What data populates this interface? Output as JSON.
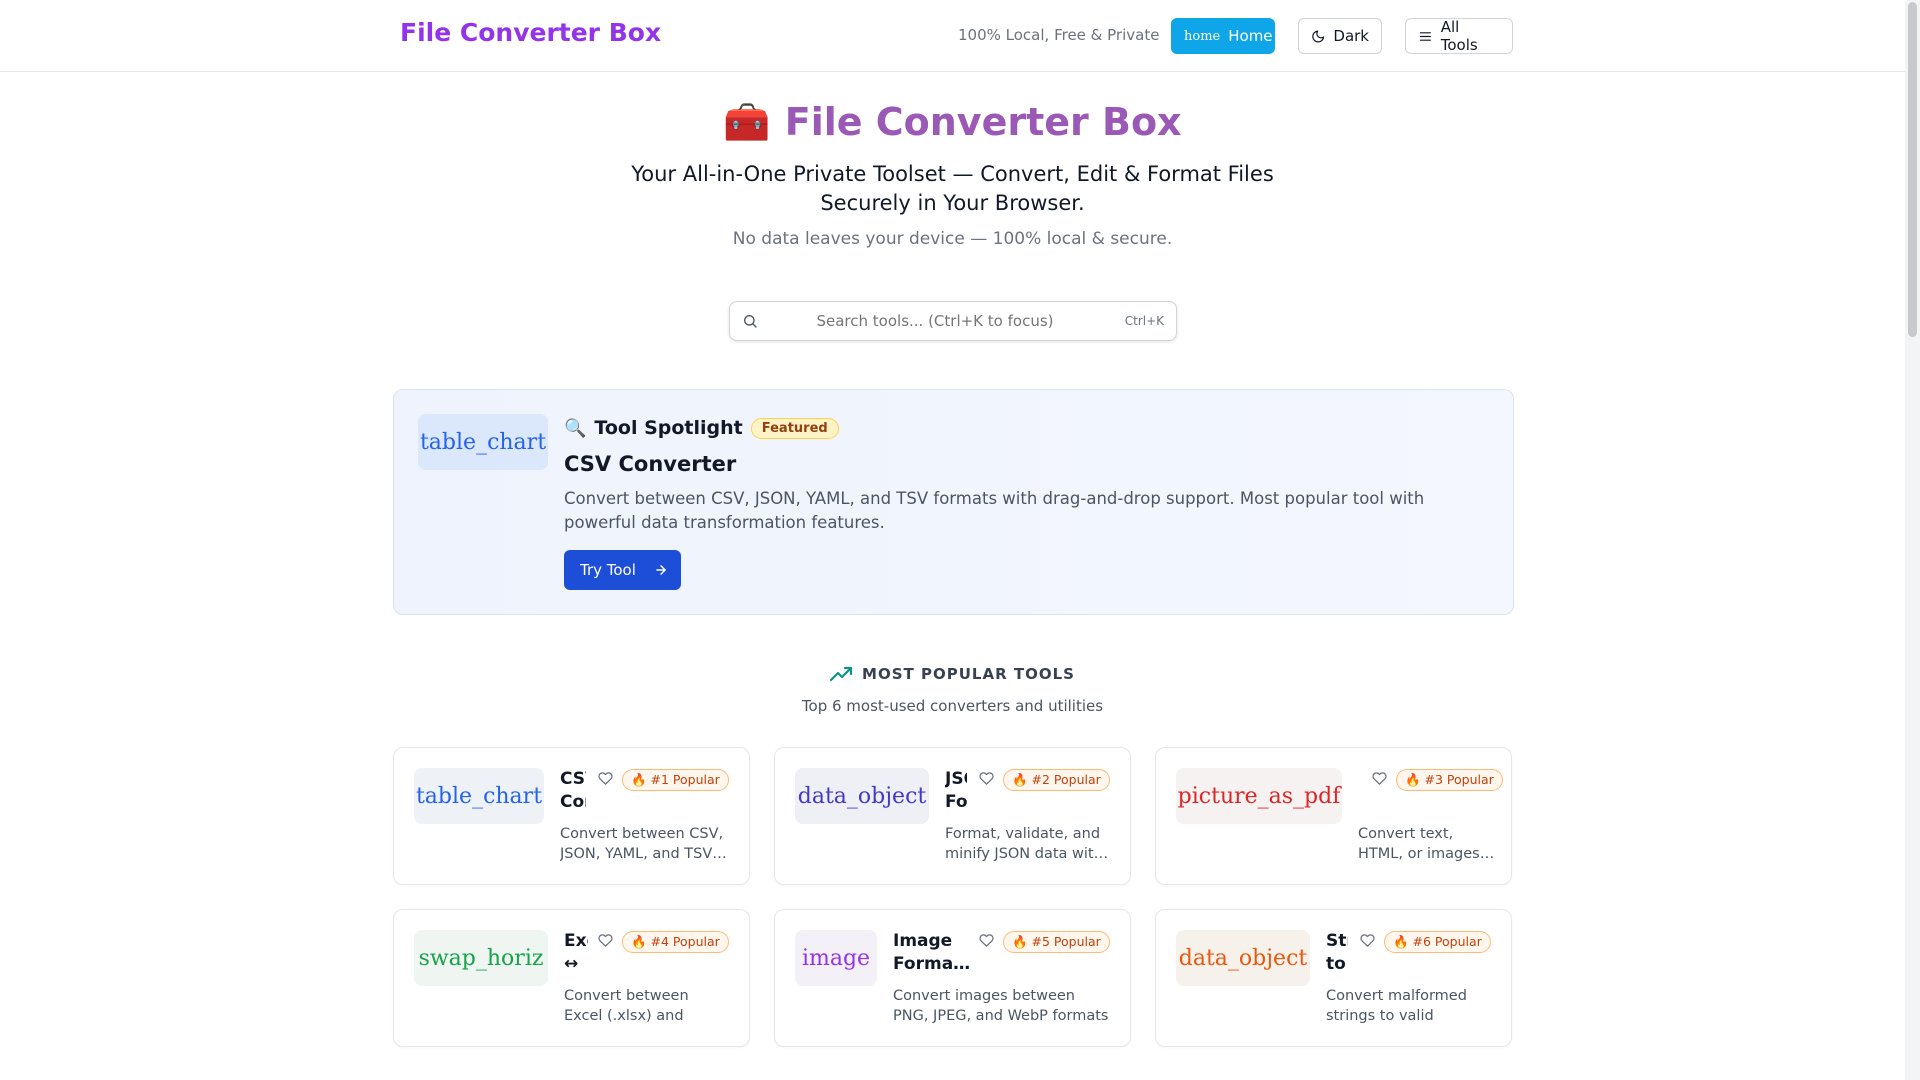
{
  "header": {
    "brand": "File Converter Box",
    "tagline": "100% Local, Free & Private",
    "home_icon": "home",
    "home_label": "Home",
    "dark_label": "Dark",
    "all_tools_label": "All Tools"
  },
  "hero": {
    "emoji": "🧰",
    "title": "File Converter Box",
    "subtitle": "Your All-in-One Private Toolset — Convert, Edit & Format Files Securely in Your Browser.",
    "note": "No data leaves your device — 100% local & secure."
  },
  "search": {
    "placeholder": "Search tools... (Ctrl+K to focus)",
    "shortcut": "Ctrl+K"
  },
  "spotlight": {
    "icon": "table_chart",
    "emoji": "🔍",
    "heading": "Tool Spotlight",
    "badge": "Featured",
    "name": "CSV Converter",
    "description": "Convert between CSV, JSON, YAML, and TSV formats with drag-and-drop support. Most popular tool with powerful data transformation features.",
    "button": "Try Tool"
  },
  "popular": {
    "heading": "MOST POPULAR TOOLS",
    "subheading": "Top 6 most-used converters and utilities",
    "cards": [
      {
        "icon": "table_chart",
        "title": "CSV Converter",
        "badge": "🔥 #1 Popular",
        "description": "Convert between CSV, JSON, YAML, and TSV…",
        "icon_color": "#2563eb",
        "icon_bg": "#eef2f7"
      },
      {
        "icon": "data_object",
        "title": "JSON Formatter",
        "badge": "🔥 #2 Popular",
        "description": "Format, validate, and minify JSON data wit…",
        "icon_color": "#4338ca",
        "icon_bg": "#eef0f6"
      },
      {
        "icon": "picture_as_pdf",
        "title": "",
        "badge": "🔥 #3 Popular",
        "description": "Convert text, HTML, or images…",
        "icon_color": "#dc2626",
        "icon_bg": "#f6f2f2"
      },
      {
        "icon": "swap_horiz",
        "title": "Excel ↔ CSV",
        "badge": "🔥 #4 Popular",
        "description": "Convert between Excel (.xlsx) and CSV…",
        "icon_color": "#16a34a",
        "icon_bg": "#eff5f0"
      },
      {
        "icon": "image",
        "title": "Image Forma…",
        "badge": "🔥 #5 Popular",
        "description": "Convert images between PNG, JPEG, and WebP formats wit…",
        "icon_color": "#9333ea",
        "icon_bg": "#f4f0f7"
      },
      {
        "icon": "data_object",
        "title": "String to JSON",
        "badge": "🔥 #6 Popular",
        "description": "Convert malformed strings to valid JSON.…",
        "icon_color": "#ea580c",
        "icon_bg": "#f7f1ec"
      }
    ]
  }
}
